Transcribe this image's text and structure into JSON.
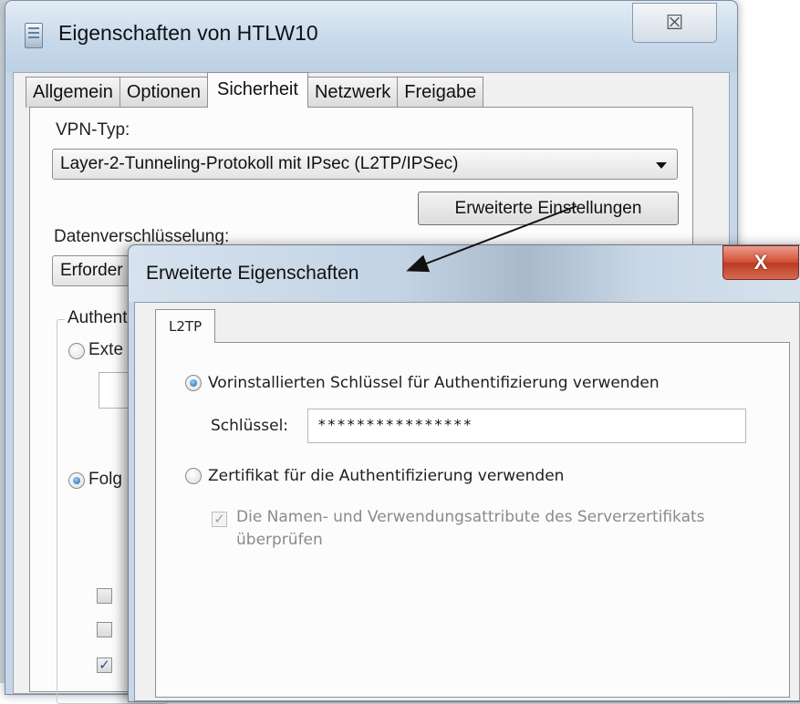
{
  "main_window": {
    "title": "Eigenschaften von HTLW10",
    "close_glyph": "☒",
    "tabs": [
      {
        "label": "Allgemein",
        "active": false
      },
      {
        "label": "Optionen",
        "active": false
      },
      {
        "label": "Sicherheit",
        "active": true
      },
      {
        "label": "Netzwerk",
        "active": false
      },
      {
        "label": "Freigabe",
        "active": false
      }
    ],
    "vpn_type_label": "VPN-Typ:",
    "vpn_type_value": "Layer-2-Tunneling-Protokoll mit IPsec (L2TP/IPSec)",
    "advanced_button": "Erweiterte Einstellungen",
    "encryption_label": "Datenverschlüsselung:",
    "encryption_value": "Erforder",
    "auth_group_label": "Authent",
    "radio_ext_label": "Exte",
    "radio_following_label": "Folg",
    "checkboxes_checked": [
      false,
      false,
      true
    ]
  },
  "dialog": {
    "title": "Erweiterte Eigenschaften",
    "close_glyph": "X",
    "tab": "L2TP",
    "radio_psk_label": "Vorinstallierten Schlüssel für Authentifizierung verwenden",
    "radio_psk_selected": true,
    "key_label": "Schlüssel:",
    "key_value": "****************",
    "radio_cert_label": "Zertifikat für die Authentifizierung verwenden",
    "radio_cert_selected": false,
    "verify_line1": "Die Namen- und Verwendungsattribute des Serverzertifikats",
    "verify_line2": "überprüfen",
    "verify_checked": true
  }
}
